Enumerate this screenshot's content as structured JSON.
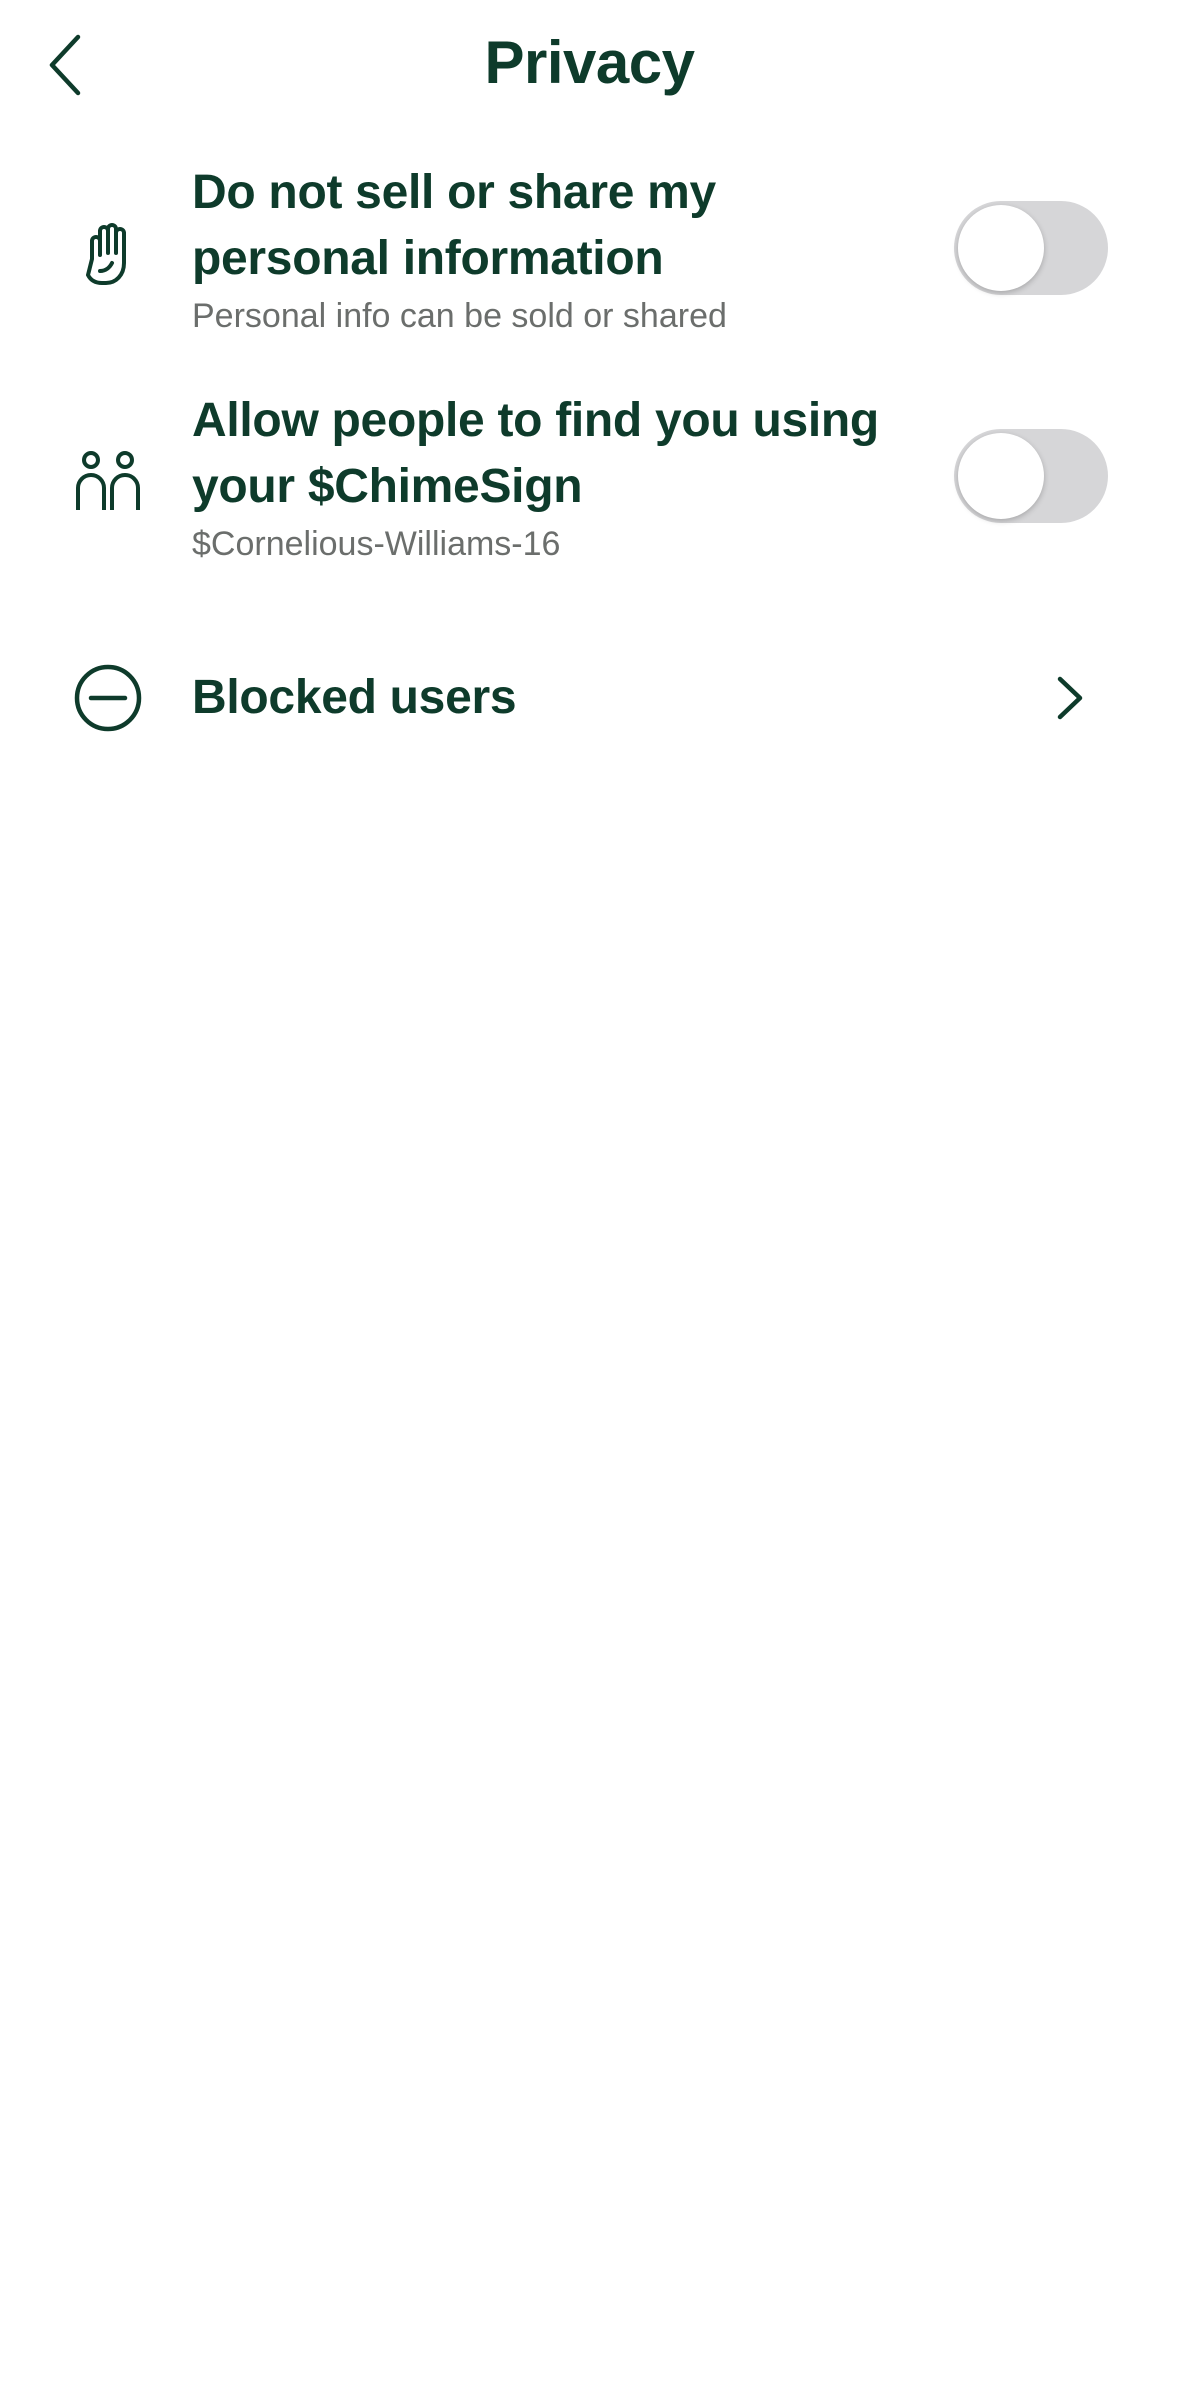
{
  "header": {
    "title": "Privacy",
    "back_icon": "chevron-left-icon"
  },
  "settings": {
    "sell_share": {
      "icon": "hand-icon",
      "title": "Do not sell or share my personal information",
      "subtitle": "Personal info can be sold or shared",
      "enabled": false
    },
    "find_by_chimesign": {
      "icon": "people-icon",
      "title": "Allow people to find you using your $ChimeSign",
      "subtitle": "$Cornelious-Williams-16",
      "enabled": false
    },
    "blocked_users": {
      "icon": "minus-circle-icon",
      "title": "Blocked users",
      "chevron_icon": "chevron-right-icon"
    }
  },
  "colors": {
    "text_primary": "#0e3b2b",
    "text_secondary": "#6b6e6c",
    "toggle_off": "#d6d6d8",
    "background": "#ffffff"
  }
}
